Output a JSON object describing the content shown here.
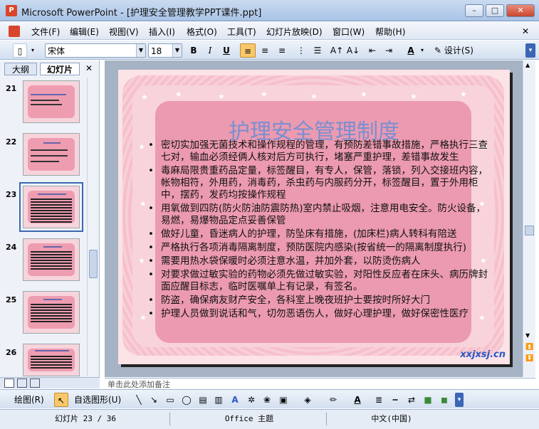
{
  "window": {
    "title": "Microsoft PowerPoint - [护理安全管理教学PPT课件.ppt]",
    "app_icon_letter": "P",
    "minimize": "–",
    "restore": "□",
    "close": "✕"
  },
  "menu": {
    "items": [
      "文件(F)",
      "编辑(E)",
      "视图(V)",
      "插入(I)",
      "格式(O)",
      "工具(T)",
      "幻灯片放映(D)",
      "窗口(W)",
      "帮助(H)"
    ]
  },
  "toolbar": {
    "font_name": "宋体",
    "font_size": "18",
    "bold": "B",
    "italic": "I",
    "underline": "U",
    "font_color": "A",
    "design_label": "设计(S)"
  },
  "left_pane": {
    "tabs": [
      "大纲",
      "幻灯片"
    ],
    "close": "✕",
    "slide_numbers": [
      "21",
      "22",
      "23",
      "24",
      "25",
      "26"
    ],
    "selected_slide": "23"
  },
  "slide": {
    "title": "护理安全管理制度",
    "bullets": [
      "密切实加强无菌技术和操作规程的管理，有预防差错事故措施，严格执行三查七对，输血必须经俩人核对后方可执行，堵塞严重护理，差错事故发生",
      "毒麻局限贵重药品定量，标签醒目，有专人，保管，落锁，列入交接班内容，帐物相符，外用药，消毒药，杀虫药与内服药分开，标签醒目，置于外用柜中，摆药，发药均按操作规程",
      "用氧做到四防(防火防油防震防热)室内禁止吸烟，注意用电安全。防火设备，易燃，易爆物品定点妥善保管",
      "做好儿童，昏迷病人的护理，防坠床有措施，(加床栏)病人转科有陪送",
      "严格执行各项消毒隔离制度，预防医院内感染(按省统一的隔离制度执行)",
      "需要用热水袋保暖时必须注意水温，并加外套，以防烫伤病人",
      "对要求做过敏实验的药物必须先做过敏实验，对阳性反应者在床头、病历牌封面应醒目标志，临时医嘱单上有记录，有签名。",
      "防盗，确保病友财产安全，各科室上晚夜班护士要按时所好大门",
      "护理人员做到说话和气，切勿恶语伤人，做好心理护理，做好保密性医疗"
    ],
    "watermark": "xxjxsj.cn"
  },
  "notes": {
    "text": "单击此处添加备注"
  },
  "drawing_toolbar": {
    "draw_label": "绘图(R)",
    "autoshape_label": "自选图形(U)"
  },
  "status": {
    "slide_indicator": "幻灯片 23 / 36",
    "theme": "Office 主题",
    "language": "中文(中国)"
  }
}
